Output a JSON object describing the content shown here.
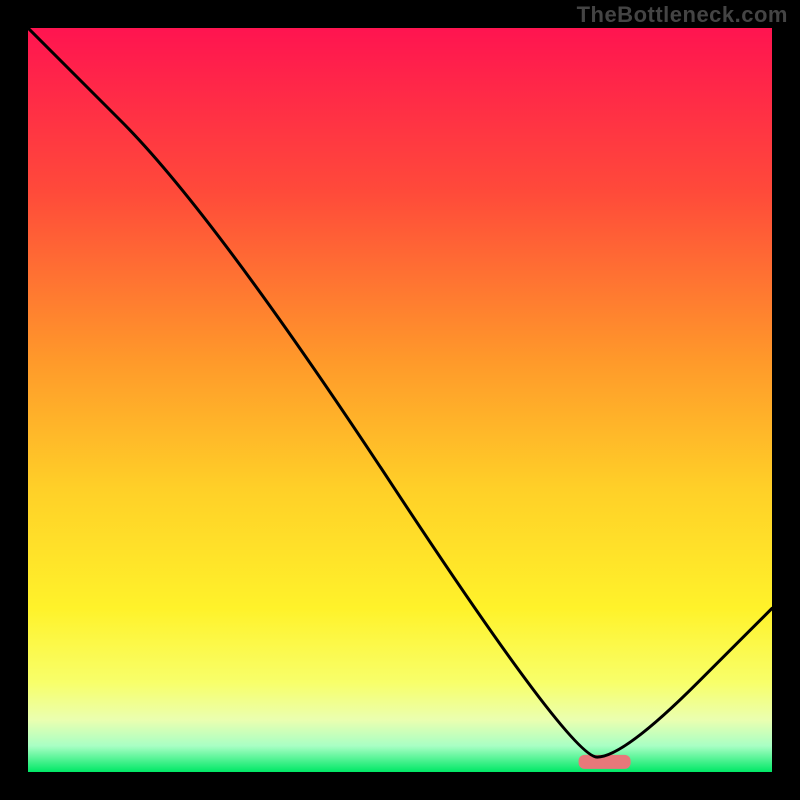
{
  "watermark": "TheBottleneck.com",
  "chart_data": {
    "type": "line",
    "title": "",
    "xlabel": "",
    "ylabel": "",
    "xlim": [
      0,
      100
    ],
    "ylim": [
      0,
      100
    ],
    "grid": false,
    "series": [
      {
        "name": "bottleneck-curve",
        "x": [
          0,
          25,
          73,
          80,
          100
        ],
        "values": [
          100,
          75,
          2,
          2,
          22
        ]
      }
    ],
    "marker": {
      "name": "highlight-segment",
      "x_start": 74,
      "x_end": 81,
      "y": 1.5,
      "color": "#e8787a"
    },
    "gradient_stops": [
      {
        "offset": 0.0,
        "color": "#ff1450"
      },
      {
        "offset": 0.22,
        "color": "#ff4a3a"
      },
      {
        "offset": 0.45,
        "color": "#ff9a2a"
      },
      {
        "offset": 0.62,
        "color": "#ffd028"
      },
      {
        "offset": 0.78,
        "color": "#fff22a"
      },
      {
        "offset": 0.88,
        "color": "#f8ff6a"
      },
      {
        "offset": 0.93,
        "color": "#eaffb0"
      },
      {
        "offset": 0.965,
        "color": "#a8ffc4"
      },
      {
        "offset": 1.0,
        "color": "#00e866"
      }
    ]
  }
}
